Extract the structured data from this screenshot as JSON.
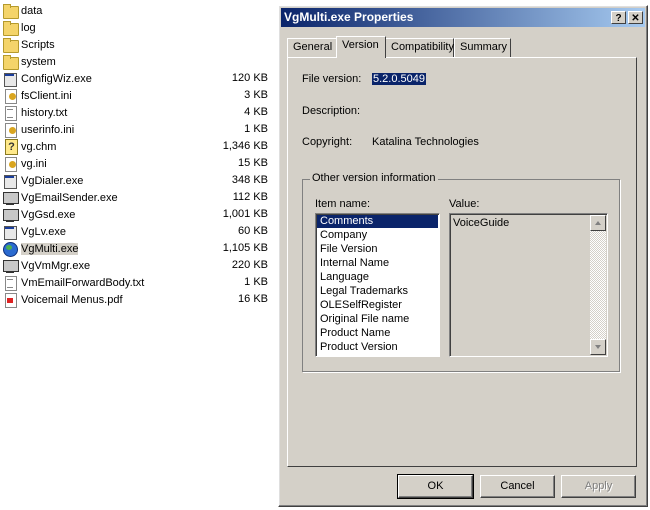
{
  "explorer": {
    "files": [
      {
        "name": "data",
        "size": "",
        "icon": "folder-icon"
      },
      {
        "name": "log",
        "size": "",
        "icon": "folder-icon"
      },
      {
        "name": "Scripts",
        "size": "",
        "icon": "folder-icon"
      },
      {
        "name": "system",
        "size": "",
        "icon": "folder-icon"
      },
      {
        "name": "ConfigWiz.exe",
        "size": "120 KB",
        "icon": "exe-icon"
      },
      {
        "name": "fsClient.ini",
        "size": "3 KB",
        "icon": "ini-icon"
      },
      {
        "name": "history.txt",
        "size": "4 KB",
        "icon": "text-file-icon"
      },
      {
        "name": "userinfo.ini",
        "size": "1 KB",
        "icon": "ini-icon"
      },
      {
        "name": "vg.chm",
        "size": "1,346 KB",
        "icon": "help-file-icon"
      },
      {
        "name": "vg.ini",
        "size": "15 KB",
        "icon": "ini-icon"
      },
      {
        "name": "VgDialer.exe",
        "size": "348 KB",
        "icon": "exe-icon"
      },
      {
        "name": "VgEmailSender.exe",
        "size": "112 KB",
        "icon": "network-icon"
      },
      {
        "name": "VgGsd.exe",
        "size": "1,001 KB",
        "icon": "network-icon"
      },
      {
        "name": "VgLv.exe",
        "size": "60 KB",
        "icon": "exe-icon"
      },
      {
        "name": "VgMulti.exe",
        "size": "1,105 KB",
        "icon": "globe-icon"
      },
      {
        "name": "VgVmMgr.exe",
        "size": "220 KB",
        "icon": "network-icon"
      },
      {
        "name": "VmEmailForwardBody.txt",
        "size": "1 KB",
        "icon": "text-file-icon"
      },
      {
        "name": "Voicemail Menus.pdf",
        "size": "16 KB",
        "icon": "pdf-icon"
      }
    ],
    "selected_file": "VgMulti.exe"
  },
  "dialog": {
    "title": "VgMulti.exe Properties",
    "help_button": "?",
    "close_button": "✕",
    "tabs": [
      "General",
      "Version",
      "Compatibility",
      "Summary"
    ],
    "active_tab": "Version",
    "file_version_label": "File version:",
    "file_version_value": "5.2.0.5049",
    "description_label": "Description:",
    "copyright_label": "Copyright:",
    "copyright_value": "Katalina Technologies",
    "group_title": "Other version information",
    "item_name_label": "Item name:",
    "value_label": "Value:",
    "items": [
      "Comments",
      "Company",
      "File Version",
      "Internal Name",
      "Language",
      "Legal Trademarks",
      "OLESelfRegister",
      "Original File name",
      "Product Name",
      "Product Version"
    ],
    "selected_item": "Comments",
    "selected_value": "VoiceGuide",
    "ok_label": "OK",
    "cancel_label": "Cancel",
    "apply_label": "Apply"
  },
  "colors": {
    "titlebar_start": "#0a246a",
    "titlebar_end": "#a6caf0",
    "selection": "#0a246a",
    "dialog_face": "#d4d0c8"
  }
}
